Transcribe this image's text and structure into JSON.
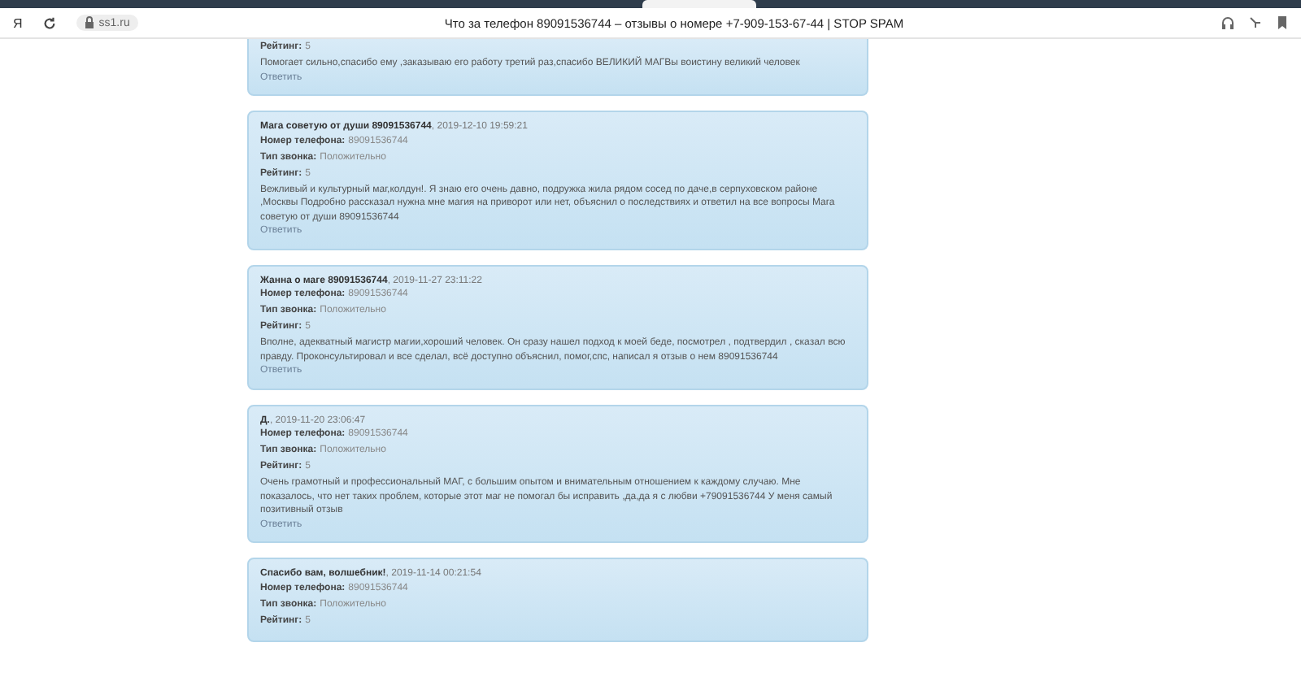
{
  "browser": {
    "logo": "Я",
    "url": "ss1.ru",
    "title": "Что за телефон 89091536744 – отзывы о номере +7-909-153-67-44 | STOP SPAM"
  },
  "reviews": [
    {
      "fields": [
        {
          "label": "Рейтинг:",
          "value": "5"
        }
      ],
      "text": "Помогает сильно,спасибо ему ,заказываю его работу третий раз,спасибо ВЕЛИКИЙ МАГВы воистину великий человек",
      "reply": "Ответить"
    },
    {
      "author": "Мага советую от души 89091536744",
      "date": ", 2019-12-10 19:59:21",
      "fields": [
        {
          "label": "Номер телефона:",
          "value": "89091536744"
        },
        {
          "label": "Тип звонка:",
          "value": "Положительно"
        },
        {
          "label": "Рейтинг:",
          "value": "5"
        }
      ],
      "text": "Вежливый и культурный маг,колдун!. Я знаю его очень давно, подружка жила рядом сосед по даче,в серпуховском районе ,Москвы Подробно рассказал нужна мне магия на приворот или нет, объяснил о последствиях и ответил на все вопросы Мага советую от души 89091536744",
      "reply": "Ответить"
    },
    {
      "author": "Жанна о маге 89091536744",
      "date": ", 2019-11-27 23:11:22",
      "fields": [
        {
          "label": "Номер телефона:",
          "value": "89091536744"
        },
        {
          "label": "Тип звонка:",
          "value": "Положительно"
        },
        {
          "label": "Рейтинг:",
          "value": "5"
        }
      ],
      "text": "Вполне, адекватный магистр магии,хороший человек. Он сразу нашел подход к моей беде, посмотрел , подтвердил , сказал всю правду. Проконсультировал и все сделал, всё доступно объяснил, помог,спс, написал я отзыв о нем 89091536744",
      "reply": "Ответить"
    },
    {
      "author": "Д.",
      "date": ", 2019-11-20 23:06:47",
      "fields": [
        {
          "label": "Номер телефона:",
          "value": "89091536744"
        },
        {
          "label": "Тип звонка:",
          "value": "Положительно"
        },
        {
          "label": "Рейтинг:",
          "value": "5"
        }
      ],
      "text": "Очень грамотный и профессиональный МАГ, с большим опытом и внимательным отношением к каждому случаю. Мне показалось, что нет таких проблем, которые этот маг не помогал бы исправить ,да,да я с любви +79091536744 У меня самый позитивный отзыв",
      "reply": "Ответить"
    },
    {
      "author": "Спасибо вам, волшебник!",
      "date": ", 2019-11-14 00:21:54",
      "fields": [
        {
          "label": "Номер телефона:",
          "value": "89091536744"
        },
        {
          "label": "Тип звонка:",
          "value": "Положительно"
        },
        {
          "label": "Рейтинг:",
          "value": "5"
        }
      ]
    }
  ]
}
